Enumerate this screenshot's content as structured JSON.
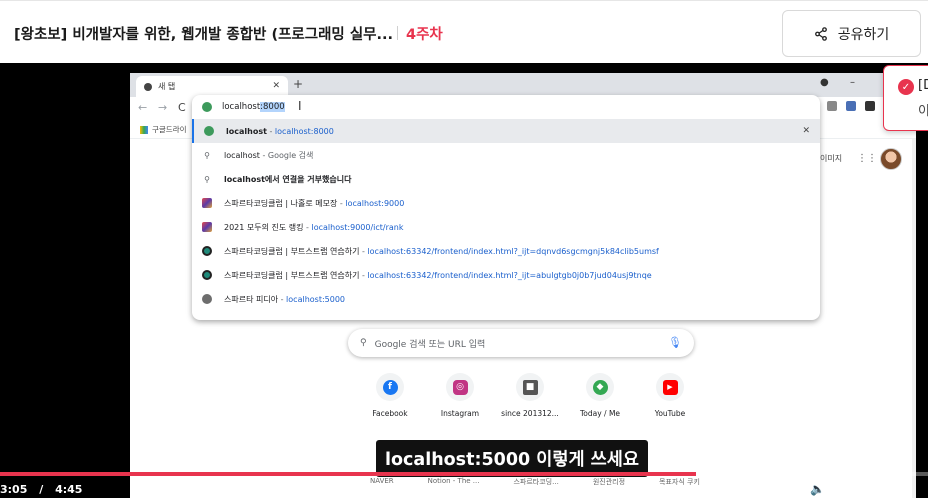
{
  "header": {
    "course_title": "[왕초보] 비개발자를 위한, 웹개발 종합반 (프로그래밍 실무...",
    "week": "4주차",
    "share_label": "공유하기"
  },
  "browser": {
    "tab_title": "새 탭",
    "bookmark_label": "구글드라이",
    "omnibox": {
      "typed": "localhost",
      "selected": ":8000",
      "suggestions": [
        {
          "main": "localhost",
          "sep": " - ",
          "url": "localhost:8000",
          "icon": "green-favicon"
        },
        {
          "main": "localhost",
          "sep": " - ",
          "url": "Google 검색",
          "icon": "search-icon"
        },
        {
          "main": "localhost에서 연결을 거부했습니다",
          "sep": "",
          "url": "",
          "icon": "search-icon"
        },
        {
          "main": "스파르타코딩클럽 | 나홀로 메모장",
          "sep": " - ",
          "url": "localhost:9000",
          "icon": "colorful-favicon"
        },
        {
          "main": "2021 모두의 진도 랭킹",
          "sep": " - ",
          "url": "localhost:9000/ict/rank",
          "icon": "colorful-favicon"
        },
        {
          "main": "스파르타코딩클럽 | 부트스트랩 연습하기",
          "sep": " - ",
          "url": "localhost:63342/frontend/index.html?_ijt=dqnvd6sgcmgnj5k84clib5umsf",
          "icon": "teal-favicon"
        },
        {
          "main": "스파르타코딩클럽 | 부트스트랩 연습하기",
          "sep": " - ",
          "url": "localhost:63342/frontend/index.html?_ijt=abulgtgb0j0b7jud04usj9tnqe",
          "icon": "teal-favicon"
        },
        {
          "main": "스파르타 피디아",
          "sep": " - ",
          "url": "localhost:5000",
          "icon": "world-favicon"
        }
      ]
    },
    "top_right_text": "이미지",
    "search_placeholder": "Google 검색 또는 URL 입력",
    "shortcuts": [
      {
        "label": "Facebook",
        "color": "#1877f2",
        "glyph": "f"
      },
      {
        "label": "Instagram",
        "color": "#c13584",
        "glyph": "◎"
      },
      {
        "label": "since 201312...",
        "color": "#555555",
        "glyph": "■"
      },
      {
        "label": "Today / Me",
        "color": "#34a853",
        "glyph": "◆"
      },
      {
        "label": "YouTube",
        "color": "#ff0000",
        "glyph": "▶"
      }
    ],
    "bottom_shortcuts": [
      "NAVER",
      "Notion - The ...",
      "스파르타코딩...",
      "원진관리정",
      "목표자식 쿠키"
    ]
  },
  "video": {
    "subtitle": "localhost:5000 이렇게 쓰세요",
    "current_time": "3:05",
    "time_sep": "/",
    "duration": "4:45",
    "progress_fraction": 0.75,
    "volume_fraction": 0.5
  },
  "toast": {
    "title": "[D",
    "subtitle": "이"
  },
  "colors": {
    "accent": "#e8344e",
    "link": "#1a5fcc"
  }
}
